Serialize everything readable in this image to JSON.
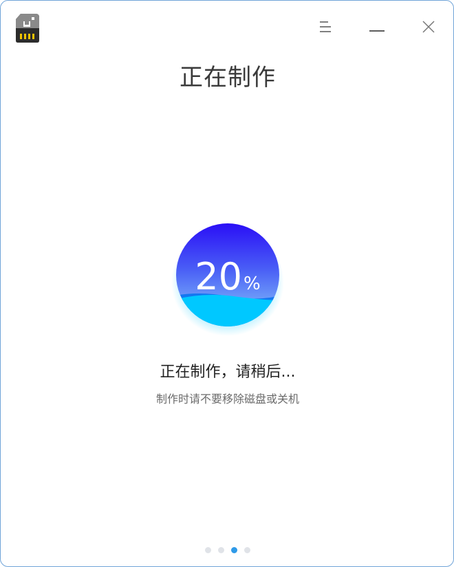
{
  "titlebar": {
    "app_icon": "sd-card-icon",
    "menu_icon": "menu-icon",
    "minimize_icon": "minimize-icon",
    "close_icon": "close-icon"
  },
  "main": {
    "title": "正在制作",
    "progress": {
      "value": "20",
      "unit": "%",
      "fraction": 0.2
    },
    "status": "正在制作，请稍后...",
    "hint": "制作时请不要移除磁盘或关机"
  },
  "pagination": {
    "total": 4,
    "active_index": 2
  },
  "colors": {
    "accent": "#2f9ae8",
    "circle_top": "#2a0ff6",
    "circle_mid": "#5f88f7",
    "wave": "#00c8ff",
    "border": "#6fa3d8"
  }
}
